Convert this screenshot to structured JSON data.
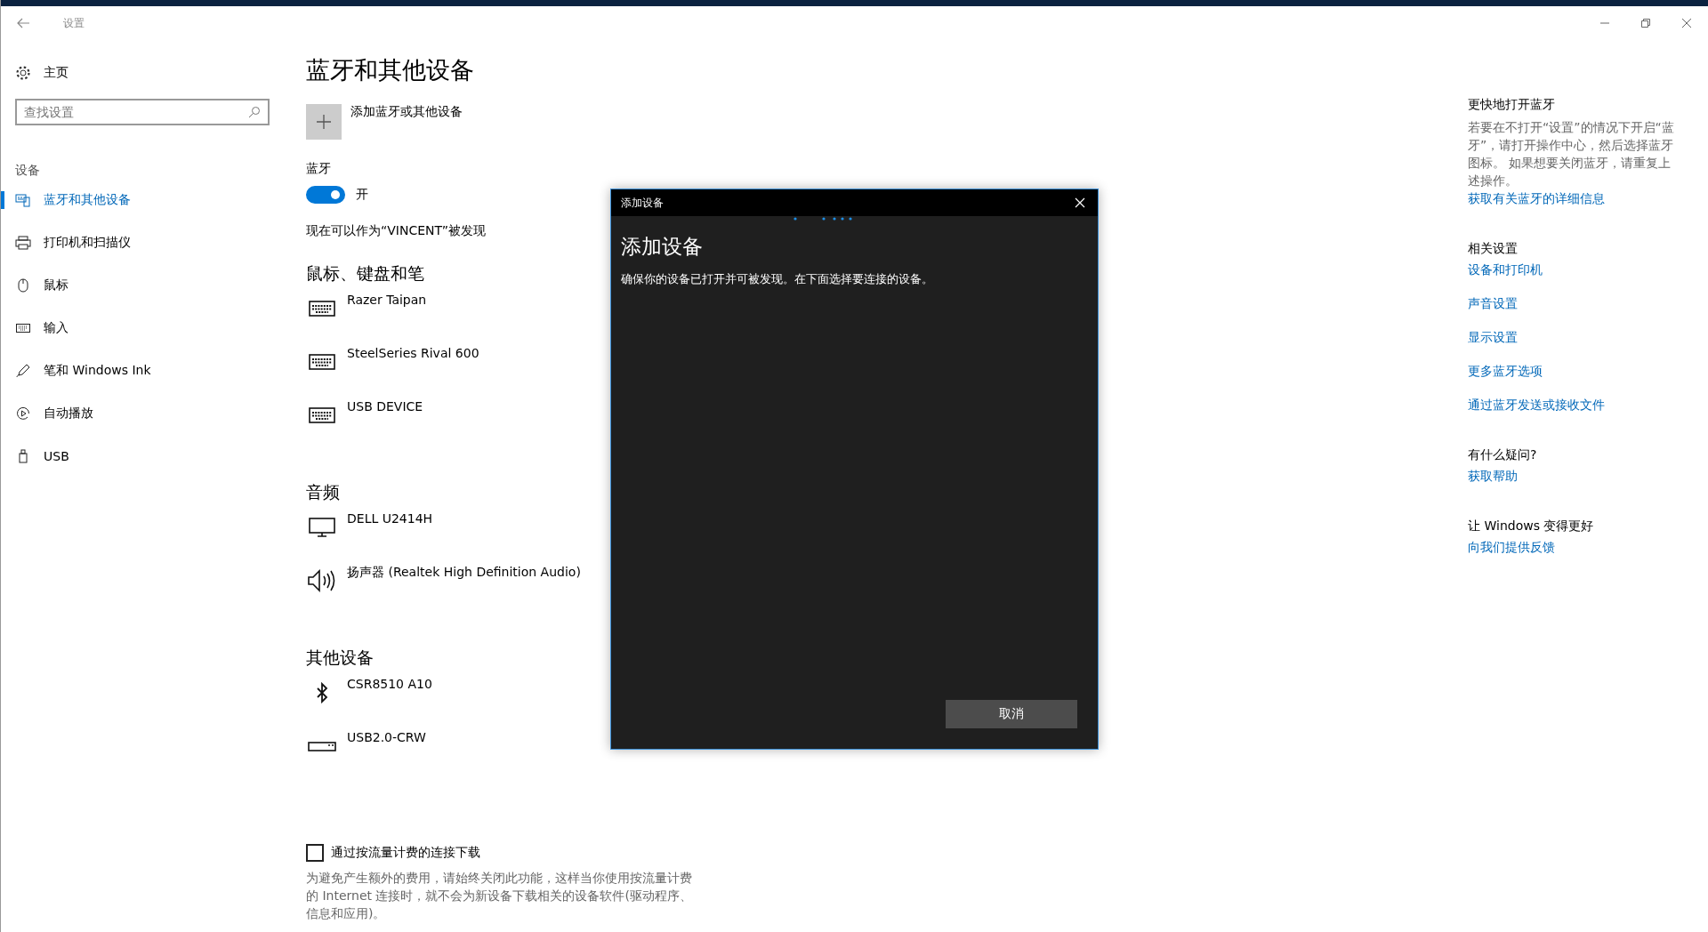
{
  "window": {
    "title": "设置"
  },
  "sidebar": {
    "home": "主页",
    "search": {
      "placeholder": "查找设置"
    },
    "section": "设备",
    "items": [
      {
        "label": "蓝牙和其他设备",
        "selected": true
      },
      {
        "label": "打印机和扫描仪",
        "selected": false
      },
      {
        "label": "鼠标",
        "selected": false
      },
      {
        "label": "输入",
        "selected": false
      },
      {
        "label": "笔和 Windows Ink",
        "selected": false
      },
      {
        "label": "自动播放",
        "selected": false
      },
      {
        "label": "USB",
        "selected": false
      }
    ]
  },
  "main": {
    "title": "蓝牙和其他设备",
    "add_device": "添加蓝牙或其他设备",
    "bluetooth_label": "蓝牙",
    "bluetooth_toggle": {
      "on": true,
      "label": "开"
    },
    "discoverable": "现在可以作为“VINCENT”被发现",
    "groups": [
      {
        "title": "鼠标、键盘和笔",
        "devices": [
          "Razer Taipan",
          "SteelSeries Rival 600",
          "USB DEVICE"
        ]
      },
      {
        "title": "音频",
        "devices": [
          "DELL U2414H",
          "扬声器 (Realtek High Definition Audio)"
        ]
      },
      {
        "title": "其他设备",
        "devices": [
          "CSR8510 A10",
          "USB2.0-CRW"
        ]
      }
    ],
    "metered": {
      "checked": false,
      "label": "通过按流量计费的连接下载",
      "description": "为避免产生额外的费用，请始终关闭此功能，这样当你使用按流量计费的 Internet 连接时，就不会为新设备下载相关的设备软件(驱动程序、信息和应用)。"
    }
  },
  "right_panel": [
    {
      "title": "更快地打开蓝牙",
      "text": "若要在不打开“设置”的情况下开启“蓝牙”，请打开操作中心，然后选择蓝牙图标。 如果想要关闭蓝牙，请重复上述操作。",
      "links": [
        "获取有关蓝牙的详细信息"
      ]
    },
    {
      "title": "相关设置",
      "links": [
        "设备和打印机",
        "声音设置",
        "显示设置",
        "更多蓝牙选项",
        "通过蓝牙发送或接收文件"
      ]
    },
    {
      "title": "有什么疑问?",
      "links": [
        "获取帮助"
      ]
    },
    {
      "title": "让 Windows 变得更好",
      "links": [
        "向我们提供反馈"
      ]
    }
  ],
  "dialog": {
    "title": "添加设备",
    "heading": "添加设备",
    "text": "确保你的设备已打开并可被发现。在下面选择要连接的设备。",
    "button": "取消"
  }
}
